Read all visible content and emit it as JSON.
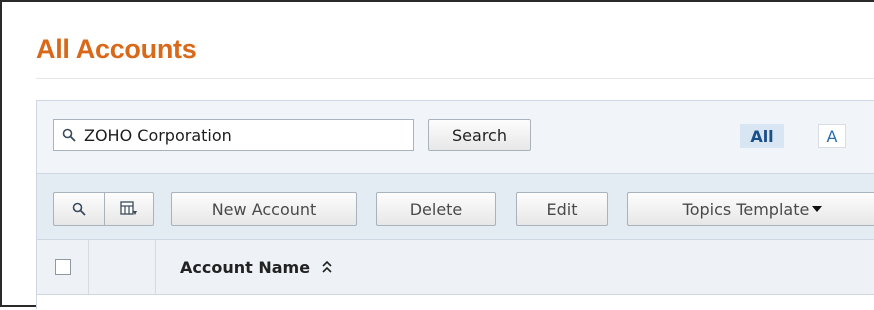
{
  "page": {
    "title": "All Accounts"
  },
  "search": {
    "value": "ZOHO Corporation",
    "button_label": "Search"
  },
  "alpha_filter": {
    "all_label": "All",
    "letter_a": "A"
  },
  "toolbar": {
    "icons": [
      "search-icon",
      "column-chooser-icon"
    ],
    "new_label": "New Account",
    "delete_label": "Delete",
    "edit_label": "Edit",
    "topics_label": "Topics Template"
  },
  "grid": {
    "columns": [
      "Account Name"
    ],
    "sort_icon": "sort-toggle-icon"
  },
  "colors": {
    "title": "#d9691a",
    "accent": "#1b4e88",
    "panel": "#f1f5f9"
  }
}
